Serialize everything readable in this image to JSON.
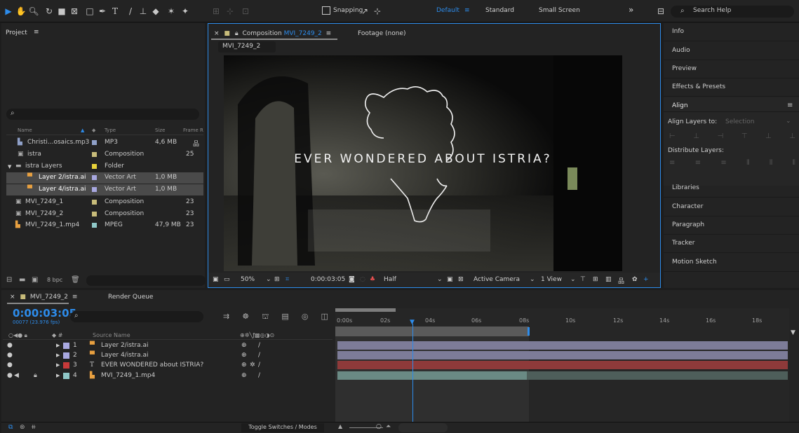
{
  "toolbar": {
    "snapping_label": "Snapping",
    "workspaces": [
      "Default",
      "Standard",
      "Small Screen"
    ],
    "more": "»",
    "search_placeholder": "Search Help",
    "accent": "#2d8ceb"
  },
  "project": {
    "title": "Project",
    "menu_icon": "≡",
    "columns": [
      "Name",
      "Type",
      "Size",
      "Frame R"
    ],
    "items": [
      {
        "name": "Christi...osaics.mp3",
        "type": "MP3",
        "size": "4,6 MB",
        "frame": "",
        "color": "#8fa0c8",
        "icon": "audio-file-icon"
      },
      {
        "name": "istra",
        "type": "Composition",
        "size": "",
        "frame": "25",
        "color": "#c8bc7a",
        "icon": "composition-icon"
      },
      {
        "name": "istra Layers",
        "type": "Folder",
        "size": "",
        "frame": "",
        "color": "#e8d23a",
        "icon": "folder-icon"
      },
      {
        "name": "Layer 2/istra.ai",
        "type": "Vector Art",
        "size": "1,0 MB",
        "frame": "",
        "color": "#a8a8e0",
        "icon": "illustrator-file-icon"
      },
      {
        "name": "Layer 4/istra.ai",
        "type": "Vector Art",
        "size": "1,0 MB",
        "frame": "",
        "color": "#a8a8e0",
        "icon": "illustrator-file-icon"
      },
      {
        "name": "MVI_7249_1",
        "type": "Composition",
        "size": "",
        "frame": "23",
        "color": "#c8bc7a",
        "icon": "composition-icon"
      },
      {
        "name": "MVI_7249_2",
        "type": "Composition",
        "size": "",
        "frame": "23",
        "color": "#c8bc7a",
        "icon": "composition-icon"
      },
      {
        "name": "MVI_7249_1.mp4",
        "type": "MPEG",
        "size": "47,9 MB",
        "frame": "23",
        "color": "#8fc8c8",
        "icon": "video-file-icon"
      }
    ],
    "bpc": "8 bpc"
  },
  "composition": {
    "tab_prefix": "Composition",
    "tab_name": "MVI_7249_2",
    "tab_menu": "≡",
    "footage_tab": "Footage (none)",
    "breadcrumb": "MVI_7249_2",
    "overlay_text": "EVER WONDERED ABOUT ISTRIA?",
    "zoom": "50%",
    "timecode": "0:00:03:05",
    "resolution": "Half",
    "camera": "Active Camera",
    "view": "1 View"
  },
  "right_panel": {
    "items": [
      "Info",
      "Audio",
      "Preview",
      "Effects & Presets"
    ],
    "align": {
      "title": "Align",
      "menu": "≡",
      "align_to_label": "Align Layers to:",
      "align_to_value": "Selection",
      "distribute_label": "Distribute Layers:"
    },
    "items_after": [
      "Libraries",
      "Character",
      "Paragraph",
      "Tracker",
      "Motion Sketch"
    ]
  },
  "timeline": {
    "tab_name": "MVI_7249_2",
    "tab_menu": "≡",
    "render_queue": "Render Queue",
    "timecode": "0:00:03:05",
    "frame_info": "00077 (23.976 fps)",
    "source_name_header": "Source Name",
    "ruler": [
      "0:00s",
      "02s",
      "04s",
      "06s",
      "08s",
      "10s",
      "12s",
      "14s",
      "16s",
      "18s"
    ],
    "layers": [
      {
        "num": "1",
        "name": "Layer 2/istra.ai",
        "label_color": "#a8a8e0",
        "bar_color": "#7d7c98",
        "icon": "illustrator-file-icon"
      },
      {
        "num": "2",
        "name": "Layer 4/istra.ai",
        "label_color": "#a8a8e0",
        "bar_color": "#7d7c98",
        "icon": "illustrator-file-icon"
      },
      {
        "num": "3",
        "name": "EVER WONDERED about ISTRIA?",
        "label_color": "#c83a3a",
        "bar_color": "#8e3a3a",
        "icon": "text-layer-icon",
        "glyph": "T"
      },
      {
        "num": "4",
        "name": "MVI_7249_1.mp4",
        "label_color": "#8fc8c8",
        "bar_color": "#5e7a75",
        "icon": "video-file-icon"
      }
    ],
    "toggle_label": "Toggle Switches / Modes"
  }
}
